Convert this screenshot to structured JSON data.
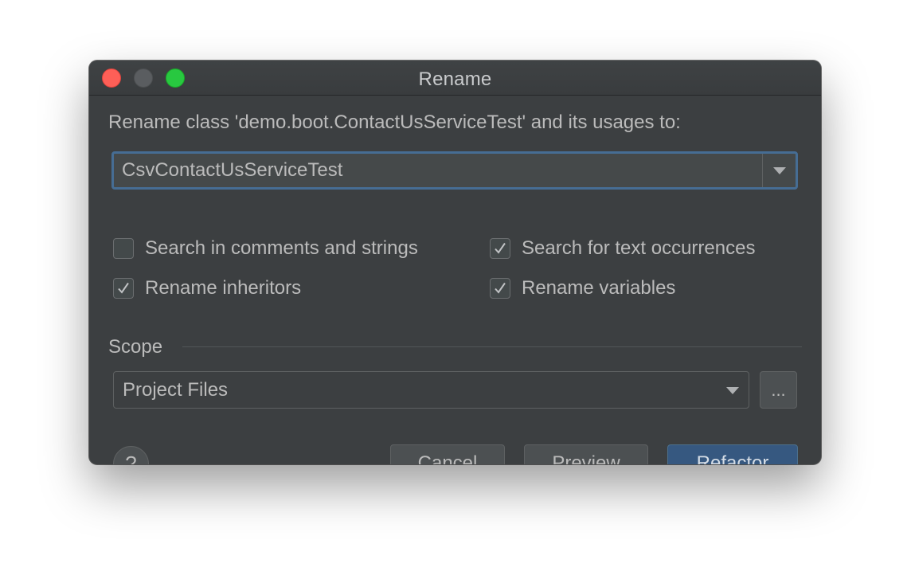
{
  "window": {
    "title": "Rename"
  },
  "dialog": {
    "prompt": "Rename class 'demo.boot.ContactUsServiceTest' and its usages to:",
    "new_name": "CsvContactUsServiceTest",
    "options": {
      "search_comments": {
        "label": "Search in comments and strings",
        "checked": false
      },
      "search_text": {
        "label": "Search for text occurrences",
        "checked": true
      },
      "rename_inheritors": {
        "label": "Rename inheritors",
        "checked": true
      },
      "rename_variables": {
        "label": "Rename variables",
        "checked": true
      }
    },
    "scope": {
      "label": "Scope",
      "value": "Project Files",
      "browse_label": "..."
    },
    "buttons": {
      "help": "?",
      "cancel": "Cancel",
      "preview": "Preview",
      "refactor": "Refactor"
    }
  },
  "colors": {
    "window_bg": "#3c3f41",
    "accent": "#365880",
    "focus_border": "#466d94",
    "text": "#bbbbbb",
    "close": "#fe5f57",
    "maximize": "#28c840"
  },
  "icons": {
    "check": "checkmark-icon",
    "dropdown": "chevron-down-icon"
  }
}
